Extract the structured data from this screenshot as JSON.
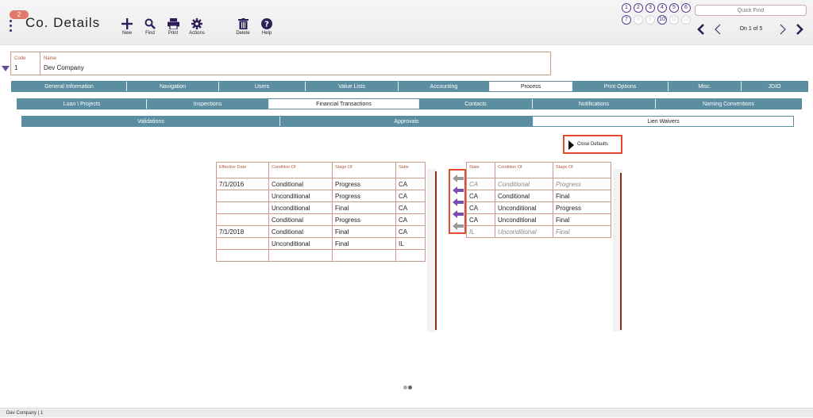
{
  "header": {
    "badge_count": "2",
    "title": "Co. Details",
    "tools": {
      "new": "New",
      "find": "Find",
      "print": "Print",
      "actions": "Actions",
      "delete": "Delete",
      "help": "Help"
    },
    "record_circles": [
      "1",
      "2",
      "3",
      "4",
      "5",
      "6",
      "7",
      "8",
      "9",
      "10",
      "11",
      "12"
    ],
    "quick_find_placeholder": "Quick Find",
    "record_position": "On 1 of 5"
  },
  "record": {
    "code_label": "Code",
    "code_value": "1",
    "name_label": "Name",
    "name_value": "Dev Company"
  },
  "tabs_main": [
    "General Information",
    "Navigation",
    "Users",
    "Value Lists",
    "Accounting",
    "Process",
    "Print Options",
    "Misc.",
    "JDIO"
  ],
  "tabs_sub": [
    "Loan \\ Projects",
    "Inspections",
    "Financial Transactions",
    "Contacts",
    "Notifications",
    "Naming Conventions"
  ],
  "tabs_sub2": [
    "Validations",
    "Approvals",
    "Lien Waivers"
  ],
  "close_defaults_label": "Close Defaults",
  "left_table": {
    "headers": [
      "Effective Date",
      "Condition Of",
      "Stage Of",
      "State"
    ],
    "rows": [
      [
        "7/1/2016",
        "Conditional",
        "Progress",
        "CA"
      ],
      [
        "",
        "Unconditional",
        "Progress",
        "CA"
      ],
      [
        "",
        "Unconditional",
        "Final",
        "CA"
      ],
      [
        "",
        "Conditional",
        "Progress",
        "CA"
      ],
      [
        "7/1/2018",
        "Conditional",
        "Final",
        "CA"
      ],
      [
        "",
        "Unconditional",
        "Final",
        "IL"
      ],
      [
        "",
        "",
        "",
        ""
      ]
    ]
  },
  "right_table": {
    "headers": [
      "State",
      "Condition Of",
      "Stage Of"
    ],
    "rows": [
      [
        "CA",
        "Conditional",
        "Progress"
      ],
      [
        "CA",
        "Conditional",
        "Final"
      ],
      [
        "CA",
        "Unconditional",
        "Progress"
      ],
      [
        "CA",
        "Unconditional",
        "Final"
      ],
      [
        "IL",
        "Unconditional",
        "Final"
      ]
    ]
  },
  "colors": {
    "tab_bg": "#5a8ea0",
    "accent_purple": "#6a4a9e",
    "highlight_red": "#e64a2e",
    "label_brown": "#b45a3a"
  },
  "footer_text": "Dev Company | 1"
}
